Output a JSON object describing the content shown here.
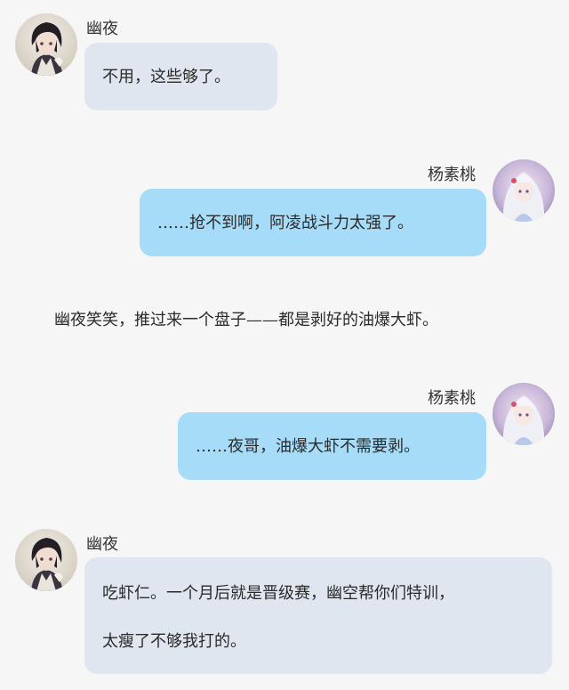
{
  "chat": {
    "m1": {
      "sender": "幽夜",
      "text": "不用，这些够了。"
    },
    "m2": {
      "sender": "杨素桃",
      "text": "……抢不到啊，阿凌战斗力太强了。"
    },
    "narration": "幽夜笑笑，推过来一个盘子——都是剥好的油爆大虾。",
    "m3": {
      "sender": "杨素桃",
      "text": "……夜哥，油爆大虾不需要剥。"
    },
    "m4": {
      "sender": "幽夜",
      "lines": [
        "吃虾仁。一个月后就是晋级赛，幽空帮你们特训，",
        "太瘦了不够我打的。"
      ]
    }
  },
  "colors": {
    "background": "#f6f6f6",
    "left_bubble": "#dfe6ef",
    "right_bubble": "#a7dcf8"
  },
  "avatars": {
    "youye": "dark-haired-boy-avatar",
    "yangsutao": "white-haired-girl-avatar"
  }
}
